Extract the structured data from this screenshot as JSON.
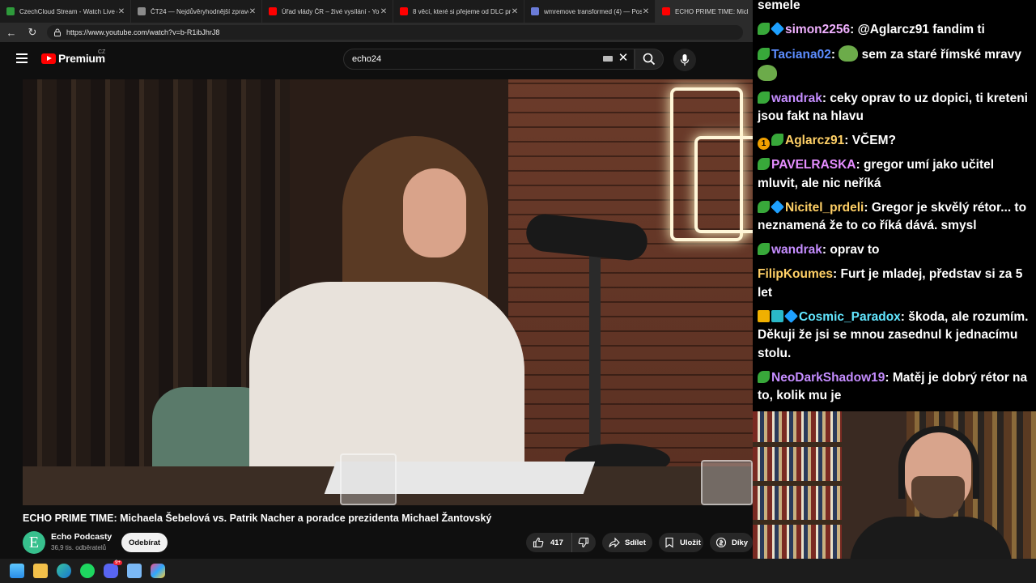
{
  "browser": {
    "tabs": [
      {
        "title": "CzechCloud Stream - Watch Live o",
        "color": "#2e9a3b",
        "active": false
      },
      {
        "title": "ČT24 — Nejdůvěryhodnější zpravo",
        "color": "#8a8a8a",
        "active": false
      },
      {
        "title": "Úřad vlády ČR – živé vysílání - You",
        "color": "#ff0000",
        "active": false
      },
      {
        "title": "8 věcí, které si přejeme od DLC pro",
        "color": "#ff0000",
        "active": false
      },
      {
        "title": "wmremove transformed (4) — Pos",
        "color": "#6a7bd8",
        "active": false
      },
      {
        "title": "ECHO PRIME TIME: Micha",
        "color": "#ff0000",
        "active": true
      }
    ],
    "url": "https://www.youtube.com/watch?v=b-R1ibJhrJ8"
  },
  "youtube": {
    "logo_text": "Premium",
    "region": "CZ",
    "search_value": "echo24",
    "video_title": "ECHO PRIME TIME: Michaela Šebelová vs. Patrik Nacher a poradce prezidenta Michael Žantovský",
    "channel": {
      "initial": "E",
      "name": "Echo Podcasty",
      "subscribers": "36,9 tis. odběratelů"
    },
    "subscribe_label": "Odebírat",
    "likes": "417",
    "share_label": "Sdílet",
    "save_label": "Uložit",
    "thanks_label": "Díky"
  },
  "chat": {
    "top_fragment": "semele",
    "messages": [
      {
        "user": "simon2256",
        "color": "#f0b0ff",
        "badges": [
          "leaf",
          "cube"
        ],
        "text": "@Aglarcz91 fandim ti"
      },
      {
        "user": "Taciana02",
        "color": "#5c8dff",
        "badges": [
          "leaf"
        ],
        "text": "sem za staré římské mravy"
      },
      {
        "user": "wandrak",
        "color": "#c58dff",
        "badges": [
          "leaf"
        ],
        "text": "ceky oprav to uz dopici, ti kreteni jsou fakt na hlavu"
      },
      {
        "user": "Aglarcz91",
        "color": "#ffd066",
        "badges": [
          "one",
          "leaf"
        ],
        "text": "VČEM?"
      },
      {
        "user": "PAVELRASKA",
        "color": "#e58dff",
        "badges": [
          "leaf"
        ],
        "text": "gregor umí jako učitel mluvit, ale nic neříká"
      },
      {
        "user": "Nicitel_prdeli",
        "color": "#ffd066",
        "badges": [
          "leaf",
          "cube"
        ],
        "text": "Gregor je skvělý rétor... to neznamená že to co říká dává. smysl"
      },
      {
        "user": "wandrak",
        "color": "#c58dff",
        "badges": [
          "leaf"
        ],
        "text": "oprav to"
      },
      {
        "user": "FilipKoumes",
        "color": "#ffd066",
        "badges": [],
        "text": "Furt je mladej, představ si za 5 let"
      },
      {
        "user": "Cosmic_Paradox",
        "color": "#62e6ff",
        "badges": [
          "crown",
          "gift",
          "cube"
        ],
        "text": "škoda, ale rozumím. Děkuji že jsi se mnou zasednul k jednacímu stolu."
      },
      {
        "user": "NeoDarkShadow19",
        "color": "#c58dff",
        "badges": [
          "leaf"
        ],
        "text": "Matěj je dobrý rétor na to, kolik mu je"
      }
    ]
  },
  "taskbar": {
    "icons": [
      "windows-icon",
      "file-explorer-icon",
      "edge-icon",
      "spotify-icon",
      "discord-icon",
      "notepad-icon",
      "copilot-icon"
    ],
    "discord_badge": "9+"
  }
}
